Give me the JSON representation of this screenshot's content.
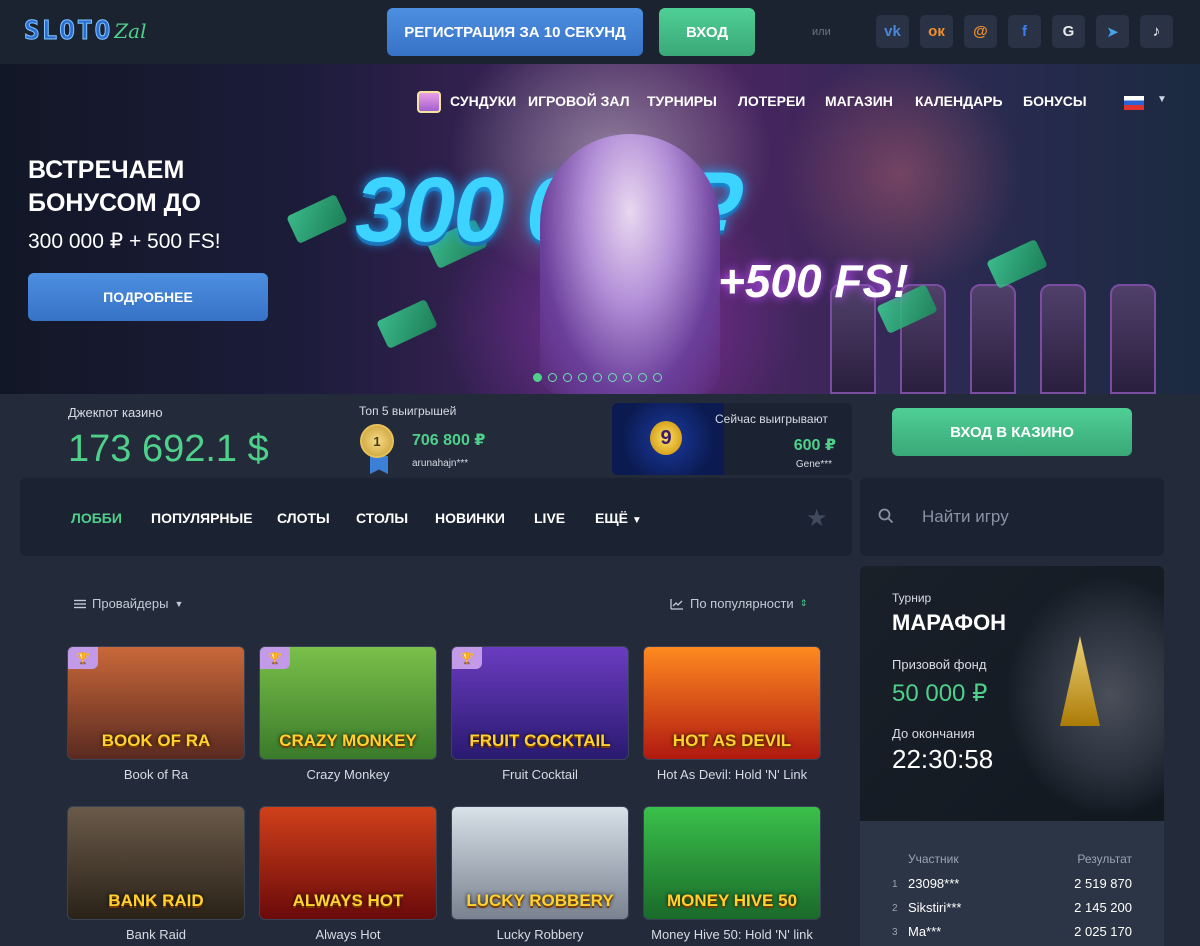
{
  "brand": {
    "logo_main": "SLOTO",
    "logo_sub": "Zal"
  },
  "header": {
    "register_label": "РЕГИСТРАЦИЯ ЗА 10 СЕКУНД",
    "login_label": "ВХОД",
    "or_text": "или",
    "socials": [
      {
        "name": "vk-icon",
        "glyph": "vk",
        "color": "#4a86d8"
      },
      {
        "name": "odnoklassniki-icon",
        "glyph": "ок",
        "color": "#f0902a"
      },
      {
        "name": "mailru-icon",
        "glyph": "@",
        "color": "#f0902a"
      },
      {
        "name": "facebook-icon",
        "glyph": "f",
        "color": "#3d7ef0"
      },
      {
        "name": "google-icon",
        "glyph": "G",
        "color": "#e8e8e8"
      },
      {
        "name": "telegram-icon",
        "glyph": "➤",
        "color": "#46a3e6"
      },
      {
        "name": "tiktok-icon",
        "glyph": "♪",
        "color": "#ffffff"
      }
    ]
  },
  "nav": {
    "items": [
      "СУНДУКИ",
      "ИГРОВОЙ ЗАЛ",
      "ТУРНИРЫ",
      "ЛОТЕРЕИ",
      "МАГАЗИН",
      "КАЛЕНДАРЬ",
      "БОНУСЫ"
    ],
    "language": "RU"
  },
  "hero": {
    "title_line1": "ВСТРЕЧАЕМ",
    "title_line2": "БОНУСОМ ДО",
    "subtitle": "300 000 ₽ + 500 FS!",
    "button_label": "ПОДРОБНЕЕ",
    "art_amount": "300 000₽",
    "art_fs": "+500 FS!",
    "slides_total": 9,
    "active_slide": 1
  },
  "stats": {
    "jackpot_label": "Джекпот казино",
    "jackpot_value": "173 692.1 $",
    "top5_label": "Топ 5 выигрышей",
    "top5_rank": "1",
    "top5_amount": "706 800 ₽",
    "top5_user": "arunahajn***",
    "now_label": "Сейчас выигрывают",
    "now_amount": "600 ₽",
    "now_user": "Gene***",
    "now_game_badge": "9",
    "casino_button": "ВХОД В КАЗИНО"
  },
  "categories": {
    "items": [
      "ЛОББИ",
      "ПОПУЛЯРНЫЕ",
      "СЛОТЫ",
      "СТОЛЫ",
      "НОВИНКИ",
      "LIVE",
      "ЕЩЁ"
    ],
    "active": "ЛОББИ"
  },
  "search": {
    "placeholder": "Найти игру"
  },
  "filters": {
    "providers_label": "Провайдеры",
    "sort_label": "По популярности"
  },
  "games": [
    {
      "name": "Book of Ra",
      "art": "BOOK OF RA",
      "trophy": true,
      "bg": "linear-gradient(#c9683a,#5a2a20)"
    },
    {
      "name": "Crazy Monkey",
      "art": "CRAZY MONKEY",
      "trophy": true,
      "bg": "linear-gradient(#7ac04a,#3a7a2a)"
    },
    {
      "name": "Fruit Cocktail",
      "art": "FRUIT COCKTAIL",
      "trophy": true,
      "bg": "linear-gradient(#6a3cc0,#2a1a70)"
    },
    {
      "name": "Hot As Devil: Hold 'N' Link",
      "art": "HOT AS DEVIL",
      "trophy": false,
      "bg": "linear-gradient(#ff8a20,#b01a10)"
    },
    {
      "name": "Bank Raid",
      "art": "BANK RAID",
      "trophy": false,
      "bg": "linear-gradient(#6a5a4a,#2a2218)"
    },
    {
      "name": "Always Hot",
      "art": "ALWAYS HOT",
      "trophy": false,
      "bg": "linear-gradient(#d0401a,#6a0a0a)"
    },
    {
      "name": "Lucky Robbery",
      "art": "LUCKY ROBBERY",
      "trophy": false,
      "bg": "linear-gradient(#d8e0e8,#7a8290)"
    },
    {
      "name": "Money Hive 50: Hold 'N' link",
      "art": "MONEY HIVE 50",
      "trophy": false,
      "bg": "linear-gradient(#3ac04a,#1a6a2a)"
    }
  ],
  "tournament": {
    "label": "Турнир",
    "name": "МАРАФОН",
    "fund_label": "Призовой фонд",
    "fund_value": "50 000 ₽",
    "end_label": "До окончания",
    "time_left": "22:30:58",
    "col_participant": "Участник",
    "col_result": "Результат",
    "leaders": [
      {
        "rank": "1",
        "user": "23098***",
        "score": "2 519 870"
      },
      {
        "rank": "2",
        "user": "Sikstiri***",
        "score": "2 145 200"
      },
      {
        "rank": "3",
        "user": "Ma***",
        "score": "2 025 170"
      }
    ]
  }
}
